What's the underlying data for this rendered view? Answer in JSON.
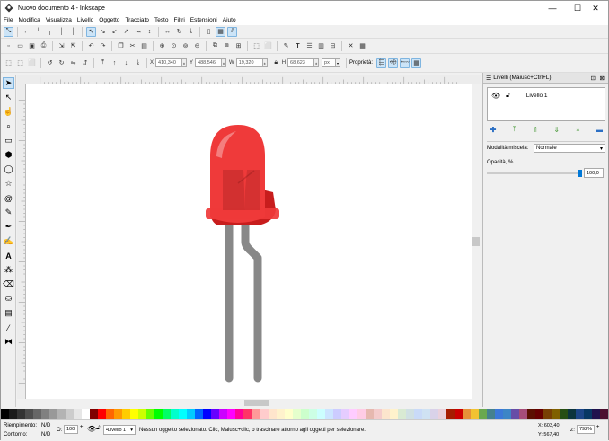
{
  "window": {
    "title": "Nuovo documento 4 - Inkscape",
    "minimize_label": "—",
    "maximize_label": "☐",
    "close_label": "✕"
  },
  "menu": [
    "File",
    "Modifica",
    "Visualizza",
    "Livello",
    "Oggetto",
    "Tracciato",
    "Testo",
    "Filtri",
    "Estensioni",
    "Aiuto"
  ],
  "controls_bar": {
    "x_label": "X",
    "x_value": "410,340",
    "y_label": "Y",
    "y_value": "488,546",
    "w_label": "W",
    "w_value": "19,320",
    "h_label": "H",
    "h_value": "68,623",
    "unit": "px",
    "properties_label": "Proprietà:"
  },
  "layers_panel": {
    "title": "Livelli (Maiusc+Ctrl+L)",
    "layer_name": "Livello 1",
    "blend_label": "Modalità miscela:",
    "blend_value": "Normale",
    "opacity_label": "Opacità, %",
    "opacity_value": "100,0",
    "opacity_fraction": 1.0
  },
  "status": {
    "fill_label": "Riempimento:",
    "fill_value": "N/D",
    "stroke_label": "Contorno:",
    "stroke_value": "N/D",
    "opacity_prefix": "O:",
    "opacity_value": "100",
    "layer_select": "•Livello 1",
    "message": "Nessun oggetto selezionato. Clic, Maiusc+clic, o trascinare attorno agli oggetti per selezionare.",
    "cursor_x": "X: 603,40",
    "cursor_y": "Y: 567,40",
    "zoom_label": "Z:",
    "zoom_value": "792%"
  },
  "colors": {
    "led_red": "#ef3a3a",
    "led_dark": "#c81d1d",
    "leg_gray": "#888888",
    "accent": "#0078d7"
  }
}
